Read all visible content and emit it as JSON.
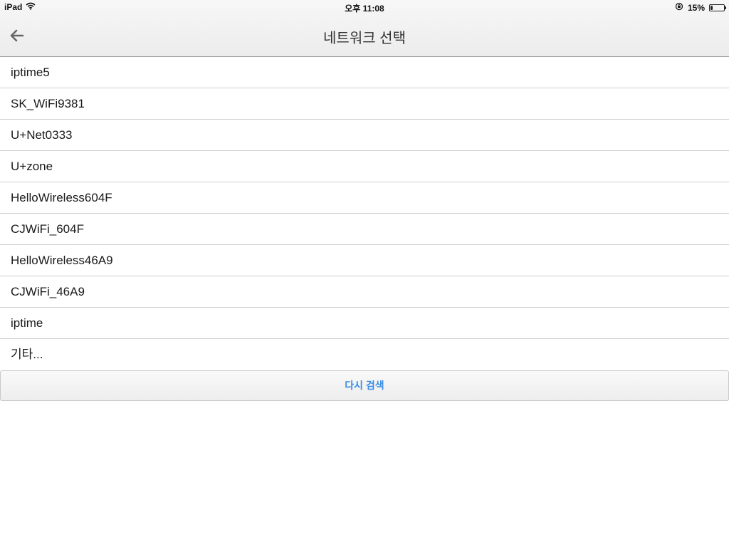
{
  "status_bar": {
    "device": "iPad",
    "time": "오후 11:08",
    "battery_text": "15%",
    "battery_level": 0.15
  },
  "nav": {
    "title": "네트워크 선택"
  },
  "networks": [
    "iptime5",
    "SK_WiFi9381",
    "U+Net0333",
    "U+zone",
    "HelloWireless604F",
    "CJWiFi_604F",
    "HelloWireless46A9",
    "CJWiFi_46A9",
    "iptime",
    "기타..."
  ],
  "actions": {
    "rescan_label": "다시 검색"
  },
  "colors": {
    "accent": "#3a8ee6",
    "navbar_bg": "#f2f2f2",
    "separator": "#cfcfcf"
  },
  "icons": {
    "wifi": "wifi-icon",
    "orientation_lock": "orientation-lock-icon",
    "battery": "battery-icon",
    "back": "back-arrow-icon"
  }
}
